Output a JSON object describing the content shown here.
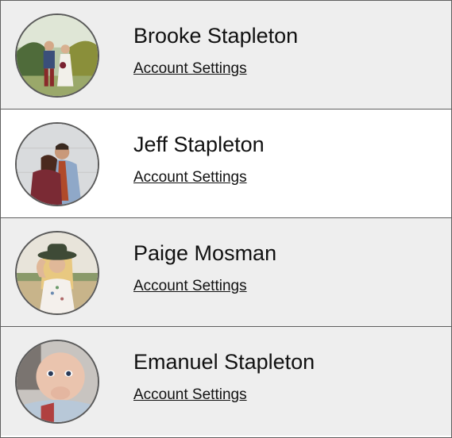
{
  "accounts": [
    {
      "name": "Brooke Stapleton",
      "settings_label": "Account Settings",
      "avatar_icon": "couple-outdoor-photo",
      "row_color": "#eeeeee"
    },
    {
      "name": "Jeff Stapleton",
      "settings_label": "Account Settings",
      "avatar_icon": "couple-embrace-photo",
      "row_color": "#ffffff"
    },
    {
      "name": "Paige Mosman",
      "settings_label": "Account Settings",
      "avatar_icon": "woman-hat-photo",
      "row_color": "#eeeeee"
    },
    {
      "name": "Emanuel Stapleton",
      "settings_label": "Account Settings",
      "avatar_icon": "baby-photo",
      "row_color": "#eeeeee"
    }
  ]
}
